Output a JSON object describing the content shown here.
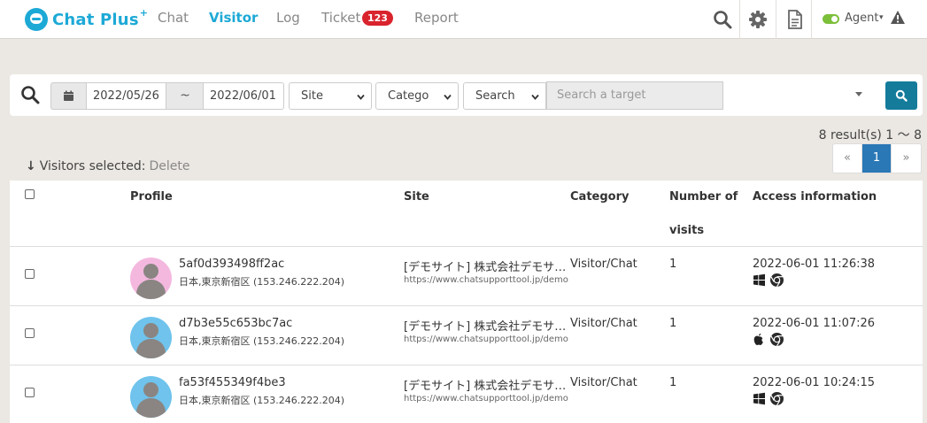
{
  "header": {
    "logo_text": "Chat Plus",
    "logo_plus": "+",
    "nav": [
      {
        "label": "Chat"
      },
      {
        "label": "Visitor"
      },
      {
        "label": "Log"
      },
      {
        "label": "Ticket"
      },
      {
        "label": "Report"
      }
    ],
    "ticket_badge": "123",
    "agent_label": "Agent",
    "agent_caret": "▾"
  },
  "search": {
    "date_from": "2022/05/26",
    "date_sep": "~",
    "date_to": "2022/06/01",
    "site_select": "Site",
    "category_select": "Catego",
    "search_select": "Search",
    "target_placeholder": "Search a target"
  },
  "results_text": "8 result(s) 1 ～ 8",
  "selection": {
    "arrow": "↓",
    "label": "Visitors selected:",
    "delete_label": "Delete"
  },
  "pager": {
    "prev": "«",
    "current": "1",
    "next": "»"
  },
  "table": {
    "columns": {
      "profile": "Profile",
      "site": "Site",
      "category": "Category",
      "visits_line1": "Number of",
      "visits_line2": "visits",
      "access": "Access information"
    },
    "rows": [
      {
        "visitor_id": "5af0d393498ff2ac",
        "location": "日本,東京新宿区 (153.246.222.204)",
        "site": "[デモサイト] 株式会社デモサイト",
        "url": "https://www.chatsupporttool.jp/demo",
        "category": "Visitor/Chat",
        "visits": "1",
        "timestamp": "2022-06-01 11:26:38",
        "os": "windows-icon",
        "browser": "chrome-icon",
        "avatar_bg": "#f4b8df"
      },
      {
        "visitor_id": "d7b3e55c653bc7ac",
        "location": "日本,東京新宿区 (153.246.222.204)",
        "site": "[デモサイト] 株式会社デモサイト",
        "url": "https://www.chatsupporttool.jp/demo",
        "category": "Visitor/Chat",
        "visits": "1",
        "timestamp": "2022-06-01 11:07:26",
        "os": "apple-icon",
        "browser": "chrome-icon",
        "avatar_bg": "#6fc3ec"
      },
      {
        "visitor_id": "fa53f455349f4be3",
        "location": "日本,東京新宿区 (153.246.222.204)",
        "site": "[デモサイト] 株式会社デモサイト",
        "url": "https://www.chatsupporttool.jp/demo",
        "category": "Visitor/Chat",
        "visits": "1",
        "timestamp": "2022-06-01 10:24:15",
        "os": "windows-icon",
        "browser": "chrome-icon",
        "avatar_bg": "#6fc3ec"
      }
    ]
  },
  "colors": {
    "brand": "#1da9d6",
    "badge": "#d9232d",
    "search_button": "#147b9b",
    "pager_active": "#2a78b6",
    "toggle_on": "#7cbf3a",
    "page_bg": "#ebe8e3"
  }
}
